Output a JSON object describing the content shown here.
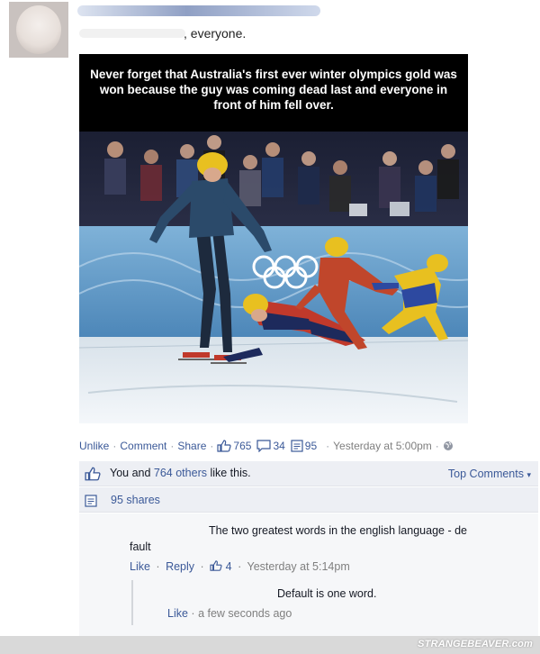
{
  "post": {
    "status_text": ", everyone.",
    "meme_caption": "Never forget that Australia's first ever winter olympics gold was won because the guy was coming dead last and everyone in front of him fell over.",
    "actions": {
      "unlike": "Unlike",
      "comment": "Comment",
      "share": "Share",
      "like_count": "765",
      "comment_count": "34",
      "share_count": "95",
      "timestamp": "Yesterday at 5:00pm"
    },
    "likes": {
      "prefix": "You and ",
      "others": "764 others",
      "suffix": " like this."
    },
    "top_comments": "Top Comments",
    "shares": "95 shares"
  },
  "comment": {
    "line1": "The two greatest words in the english language - de",
    "line2": "fault",
    "like": "Like",
    "reply": "Reply",
    "like_count": "4",
    "timestamp": "Yesterday at 5:14pm"
  },
  "reply": {
    "text": "Default is one word.",
    "like": "Like",
    "timestamp": "a few seconds ago"
  },
  "watermark": "STRANGEBEAVER.com",
  "colors": {
    "link": "#3b5998",
    "meta_gray": "#7f7f7f",
    "panel_bg": "#edeff4",
    "comment_bg": "#f6f7f9"
  }
}
